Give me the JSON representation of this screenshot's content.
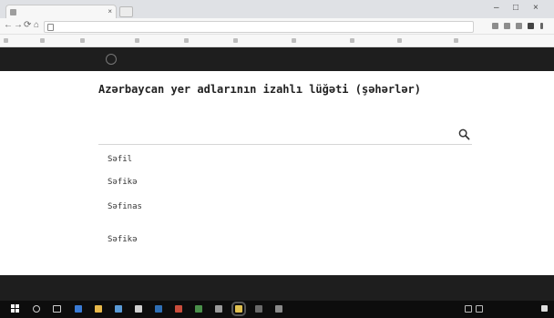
{
  "browser": {
    "tab_title": "",
    "tab_close": "×",
    "url": "",
    "window_controls": {
      "minimize": "–",
      "maximize": "□",
      "close": "×"
    },
    "nav": {
      "back": "←",
      "forward": "→",
      "reload": "⟳",
      "home": "⌂"
    },
    "bookmarks": [
      "",
      "",
      "",
      "",
      "",
      "",
      "",
      "",
      "",
      ""
    ]
  },
  "site": {
    "nav": [
      "",
      "",
      "",
      "",
      ""
    ]
  },
  "main": {
    "title": "Azərbaycan yer adlarının izahlı lüğəti (şəhərlər)",
    "subtitle": "",
    "search": {
      "placeholder": "",
      "value": ""
    },
    "entries": [
      {
        "word": "Səfil",
        "desc": ""
      },
      {
        "word": "Səfikə",
        "desc": ""
      },
      {
        "word": "Səfinas",
        "desc": ""
      },
      {
        "word": "Səfikə",
        "desc": ""
      }
    ]
  },
  "footer": {
    "left": "",
    "right": ""
  },
  "taskbar": {
    "clock_time": "",
    "clock_date": ""
  },
  "colors": {
    "header_bg": "#1e1e1e",
    "footer_bg": "#1e1e1e",
    "taskbar_bg": "#0d0d0d",
    "page_bg": "#ffffff"
  }
}
